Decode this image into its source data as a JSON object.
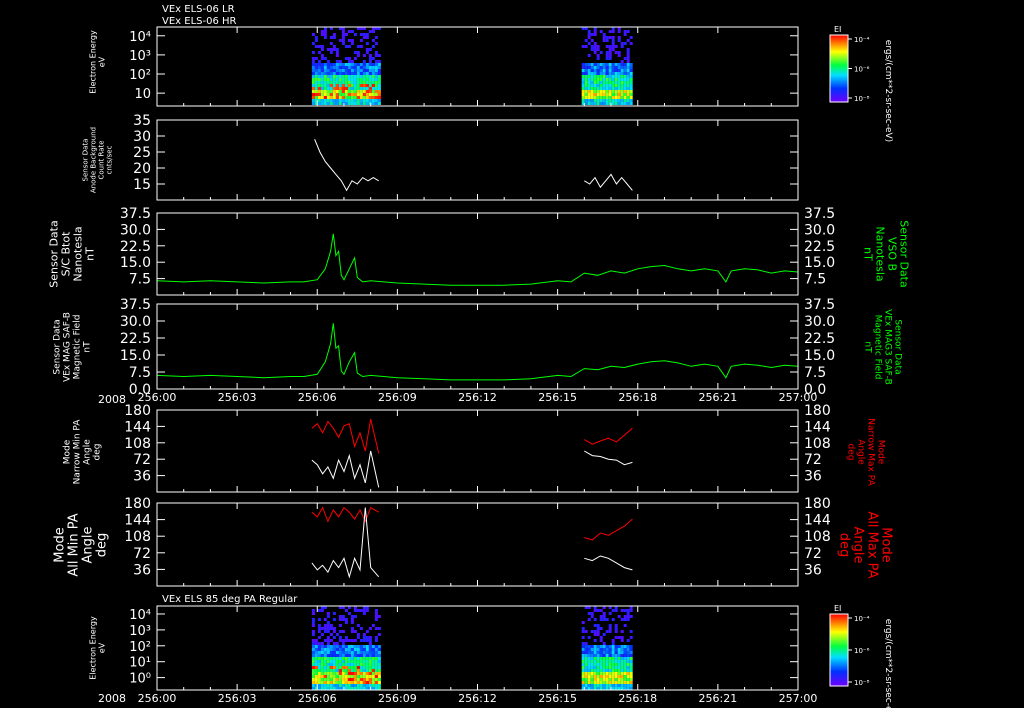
{
  "header": {
    "line1": "VEx ELS-06 LR",
    "line2": "VEx ELS-06 HR",
    "bottom_title": "VEx ELS 85 deg PA Regular"
  },
  "colors": {
    "background": "#000000",
    "axis": "#ffffff",
    "trace_white": "#ffffff",
    "trace_green": "#00ff00",
    "trace_red": "#ff0000"
  },
  "time_axis": {
    "year": "2008",
    "ticks": [
      "256:00",
      "256:03",
      "256:06",
      "256:09",
      "256:12",
      "256:15",
      "256:18",
      "256:21",
      "257:00"
    ],
    "range_minutes": [
      0,
      24
    ]
  },
  "colorbars": {
    "label": "EI",
    "unit": "ergs/(cm**2-sr-sec-eV)",
    "ticks": [
      "10⁻⁴",
      "10⁻⁶",
      "10⁻⁸"
    ]
  },
  "chart_data": [
    {
      "type": "heatmap",
      "ylabel": [
        "Electron Energy",
        "eV"
      ],
      "yscale": "log",
      "ytick_labels": [
        "10",
        "10²",
        "10³",
        "10⁴"
      ],
      "data_intervals_minutes": [
        [
          5.8,
          8.3
        ],
        [
          15.9,
          17.8
        ]
      ],
      "colormap": "rainbow",
      "colorbar": "EI"
    },
    {
      "type": "line",
      "ylabel": [
        "Sensor Data",
        "Anode Background",
        "Count Rate",
        "cnts/sec"
      ],
      "ylim": [
        10,
        35
      ],
      "ytick_labels": [
        "15",
        "20",
        "25",
        "30",
        "35"
      ],
      "series": [
        {
          "color": "#ffffff",
          "x": [
            5.9,
            6.1,
            6.3,
            6.5,
            6.7,
            6.9,
            7.1,
            7.3,
            7.5,
            7.7,
            7.9,
            8.1,
            8.3
          ],
          "y": [
            29,
            25,
            22,
            20,
            18,
            16,
            13,
            16,
            15,
            17,
            16,
            17,
            16
          ]
        },
        {
          "color": "#ffffff",
          "x": [
            16.0,
            16.2,
            16.4,
            16.6,
            16.8,
            17.0,
            17.2,
            17.4,
            17.6,
            17.8
          ],
          "y": [
            16,
            15,
            17,
            14,
            16,
            18,
            15,
            17,
            15,
            13
          ]
        }
      ]
    },
    {
      "type": "line",
      "ylabel": [
        "Sensor Data",
        "S/C Btot",
        "Nanotesla",
        "nT"
      ],
      "ylabel_right": [
        "Sensor Data",
        "VSO B",
        "Nanotesla",
        "nT"
      ],
      "ylim": [
        0,
        37.5
      ],
      "ytick_labels": [
        "7.5",
        "15.0",
        "22.5",
        "30.0",
        "37.5"
      ],
      "series": [
        {
          "color": "#00ff00",
          "x": [
            0,
            1,
            2,
            3,
            4,
            5,
            5.5,
            6,
            6.3,
            6.5,
            6.6,
            6.7,
            6.8,
            6.9,
            7.0,
            7.2,
            7.4,
            7.5,
            7.7,
            8,
            9,
            10,
            11,
            12,
            13,
            14,
            15,
            15.5,
            16,
            16.5,
            17,
            17.5,
            18,
            18.5,
            19,
            19.5,
            20,
            20.5,
            21,
            21.3,
            21.5,
            22,
            22.5,
            23,
            23.5,
            24
          ],
          "y": [
            6.5,
            6,
            6.5,
            6,
            5.5,
            6,
            6,
            7,
            12,
            20,
            28,
            18,
            20,
            9,
            7,
            12,
            17,
            8,
            6,
            6.5,
            5.5,
            5,
            4.5,
            4.5,
            4.5,
            5,
            6.5,
            6,
            10,
            9,
            11,
            10,
            12,
            13,
            13.5,
            12,
            11,
            12,
            11,
            6,
            11,
            12,
            11.5,
            10,
            11,
            10.5
          ]
        }
      ]
    },
    {
      "type": "line",
      "ylabel": [
        "Sensor Data",
        "VEx MAG SAF-B",
        "Magnetic Field",
        "nT"
      ],
      "ylabel_right": [
        "Sensor Data",
        "VEx MAG3 SAF-B",
        "Magnetic Field",
        "nT"
      ],
      "ylim": [
        0,
        37.5
      ],
      "ytick_labels": [
        "0.0",
        "7.5",
        "15.0",
        "22.5",
        "30.0",
        "37.5"
      ],
      "series": [
        {
          "color": "#00ff00",
          "x": [
            0,
            1,
            2,
            3,
            4,
            5,
            5.5,
            6,
            6.3,
            6.5,
            6.6,
            6.7,
            6.8,
            6.9,
            7.0,
            7.2,
            7.4,
            7.5,
            7.7,
            8,
            9,
            10,
            11,
            12,
            13,
            14,
            15,
            15.5,
            16,
            16.5,
            17,
            17.5,
            18,
            18.5,
            19,
            19.5,
            20,
            20.5,
            21,
            21.3,
            21.5,
            22,
            22.5,
            23,
            23.5,
            24
          ],
          "y": [
            6,
            5.5,
            6,
            5.5,
            5,
            5.5,
            5.5,
            6.5,
            12,
            20,
            29,
            18,
            19,
            8,
            6.5,
            12,
            16,
            7,
            5.5,
            6,
            5,
            4.5,
            4,
            4,
            4,
            4.5,
            6,
            5.5,
            9,
            8.5,
            10,
            9.5,
            11,
            12,
            12.5,
            11.5,
            10,
            11,
            10,
            5,
            10,
            11,
            10.5,
            9.5,
            10.5,
            10
          ]
        }
      ]
    },
    {
      "type": "line",
      "ylabel": [
        "Mode",
        "Narrow Min PA",
        "Angle",
        "deg"
      ],
      "ylabel_right": [
        "Mode",
        "Narrow Max PA",
        "Angle",
        "deg"
      ],
      "ylim": [
        0,
        180
      ],
      "ytick_labels": [
        "36",
        "72",
        "108",
        "144",
        "180"
      ],
      "series": [
        {
          "color": "#ff0000",
          "x": [
            5.8,
            6.0,
            6.2,
            6.4,
            6.6,
            6.8,
            7.0,
            7.2,
            7.4,
            7.6,
            7.8,
            8.0,
            8.3
          ],
          "y": [
            140,
            150,
            130,
            155,
            140,
            120,
            145,
            150,
            100,
            130,
            90,
            160,
            85
          ]
        },
        {
          "color": "#ffffff",
          "x": [
            5.8,
            6.0,
            6.2,
            6.4,
            6.6,
            6.8,
            7.0,
            7.2,
            7.4,
            7.6,
            7.8,
            8.0,
            8.3
          ],
          "y": [
            70,
            60,
            40,
            55,
            30,
            70,
            45,
            80,
            30,
            60,
            20,
            90,
            10
          ]
        },
        {
          "color": "#ff0000",
          "x": [
            16.0,
            16.3,
            16.6,
            16.9,
            17.2,
            17.5,
            17.8
          ],
          "y": [
            115,
            105,
            112,
            118,
            110,
            125,
            140
          ]
        },
        {
          "color": "#ffffff",
          "x": [
            16.0,
            16.3,
            16.6,
            16.9,
            17.2,
            17.5,
            17.8
          ],
          "y": [
            90,
            80,
            78,
            72,
            70,
            60,
            65
          ]
        }
      ]
    },
    {
      "type": "line",
      "ylabel": [
        "Mode",
        "All Min PA",
        "Angle",
        "deg"
      ],
      "ylabel_right": [
        "Mode",
        "All Max PA",
        "Angle",
        "deg"
      ],
      "ylim": [
        0,
        180
      ],
      "ytick_labels": [
        "36",
        "72",
        "108",
        "144",
        "180"
      ],
      "series": [
        {
          "color": "#ff0000",
          "x": [
            5.8,
            6.0,
            6.2,
            6.4,
            6.6,
            6.8,
            7.0,
            7.2,
            7.4,
            7.6,
            7.8,
            8.0,
            8.3
          ],
          "y": [
            160,
            150,
            170,
            140,
            165,
            150,
            170,
            160,
            145,
            165,
            140,
            170,
            160
          ]
        },
        {
          "color": "#ffffff",
          "x": [
            5.8,
            6.0,
            6.2,
            6.4,
            6.6,
            6.8,
            7.0,
            7.2,
            7.4,
            7.6,
            7.8,
            8.0,
            8.3
          ],
          "y": [
            50,
            35,
            45,
            30,
            55,
            40,
            60,
            20,
            60,
            35,
            170,
            40,
            20
          ]
        },
        {
          "color": "#ff0000",
          "x": [
            16.0,
            16.3,
            16.6,
            16.9,
            17.2,
            17.5,
            17.8
          ],
          "y": [
            105,
            100,
            115,
            110,
            120,
            130,
            145
          ]
        },
        {
          "color": "#ffffff",
          "x": [
            16.0,
            16.3,
            16.6,
            16.9,
            17.2,
            17.5,
            17.8
          ],
          "y": [
            60,
            55,
            65,
            60,
            50,
            40,
            35
          ]
        }
      ]
    },
    {
      "type": "heatmap",
      "ylabel": [
        "Electron Energy",
        "eV"
      ],
      "yscale": "log",
      "ytick_labels": [
        "10⁰",
        "10¹",
        "10²",
        "10³",
        "10⁴"
      ],
      "data_intervals_minutes": [
        [
          5.8,
          8.3
        ],
        [
          15.9,
          17.8
        ]
      ],
      "colormap": "rainbow",
      "colorbar": "EI"
    }
  ]
}
